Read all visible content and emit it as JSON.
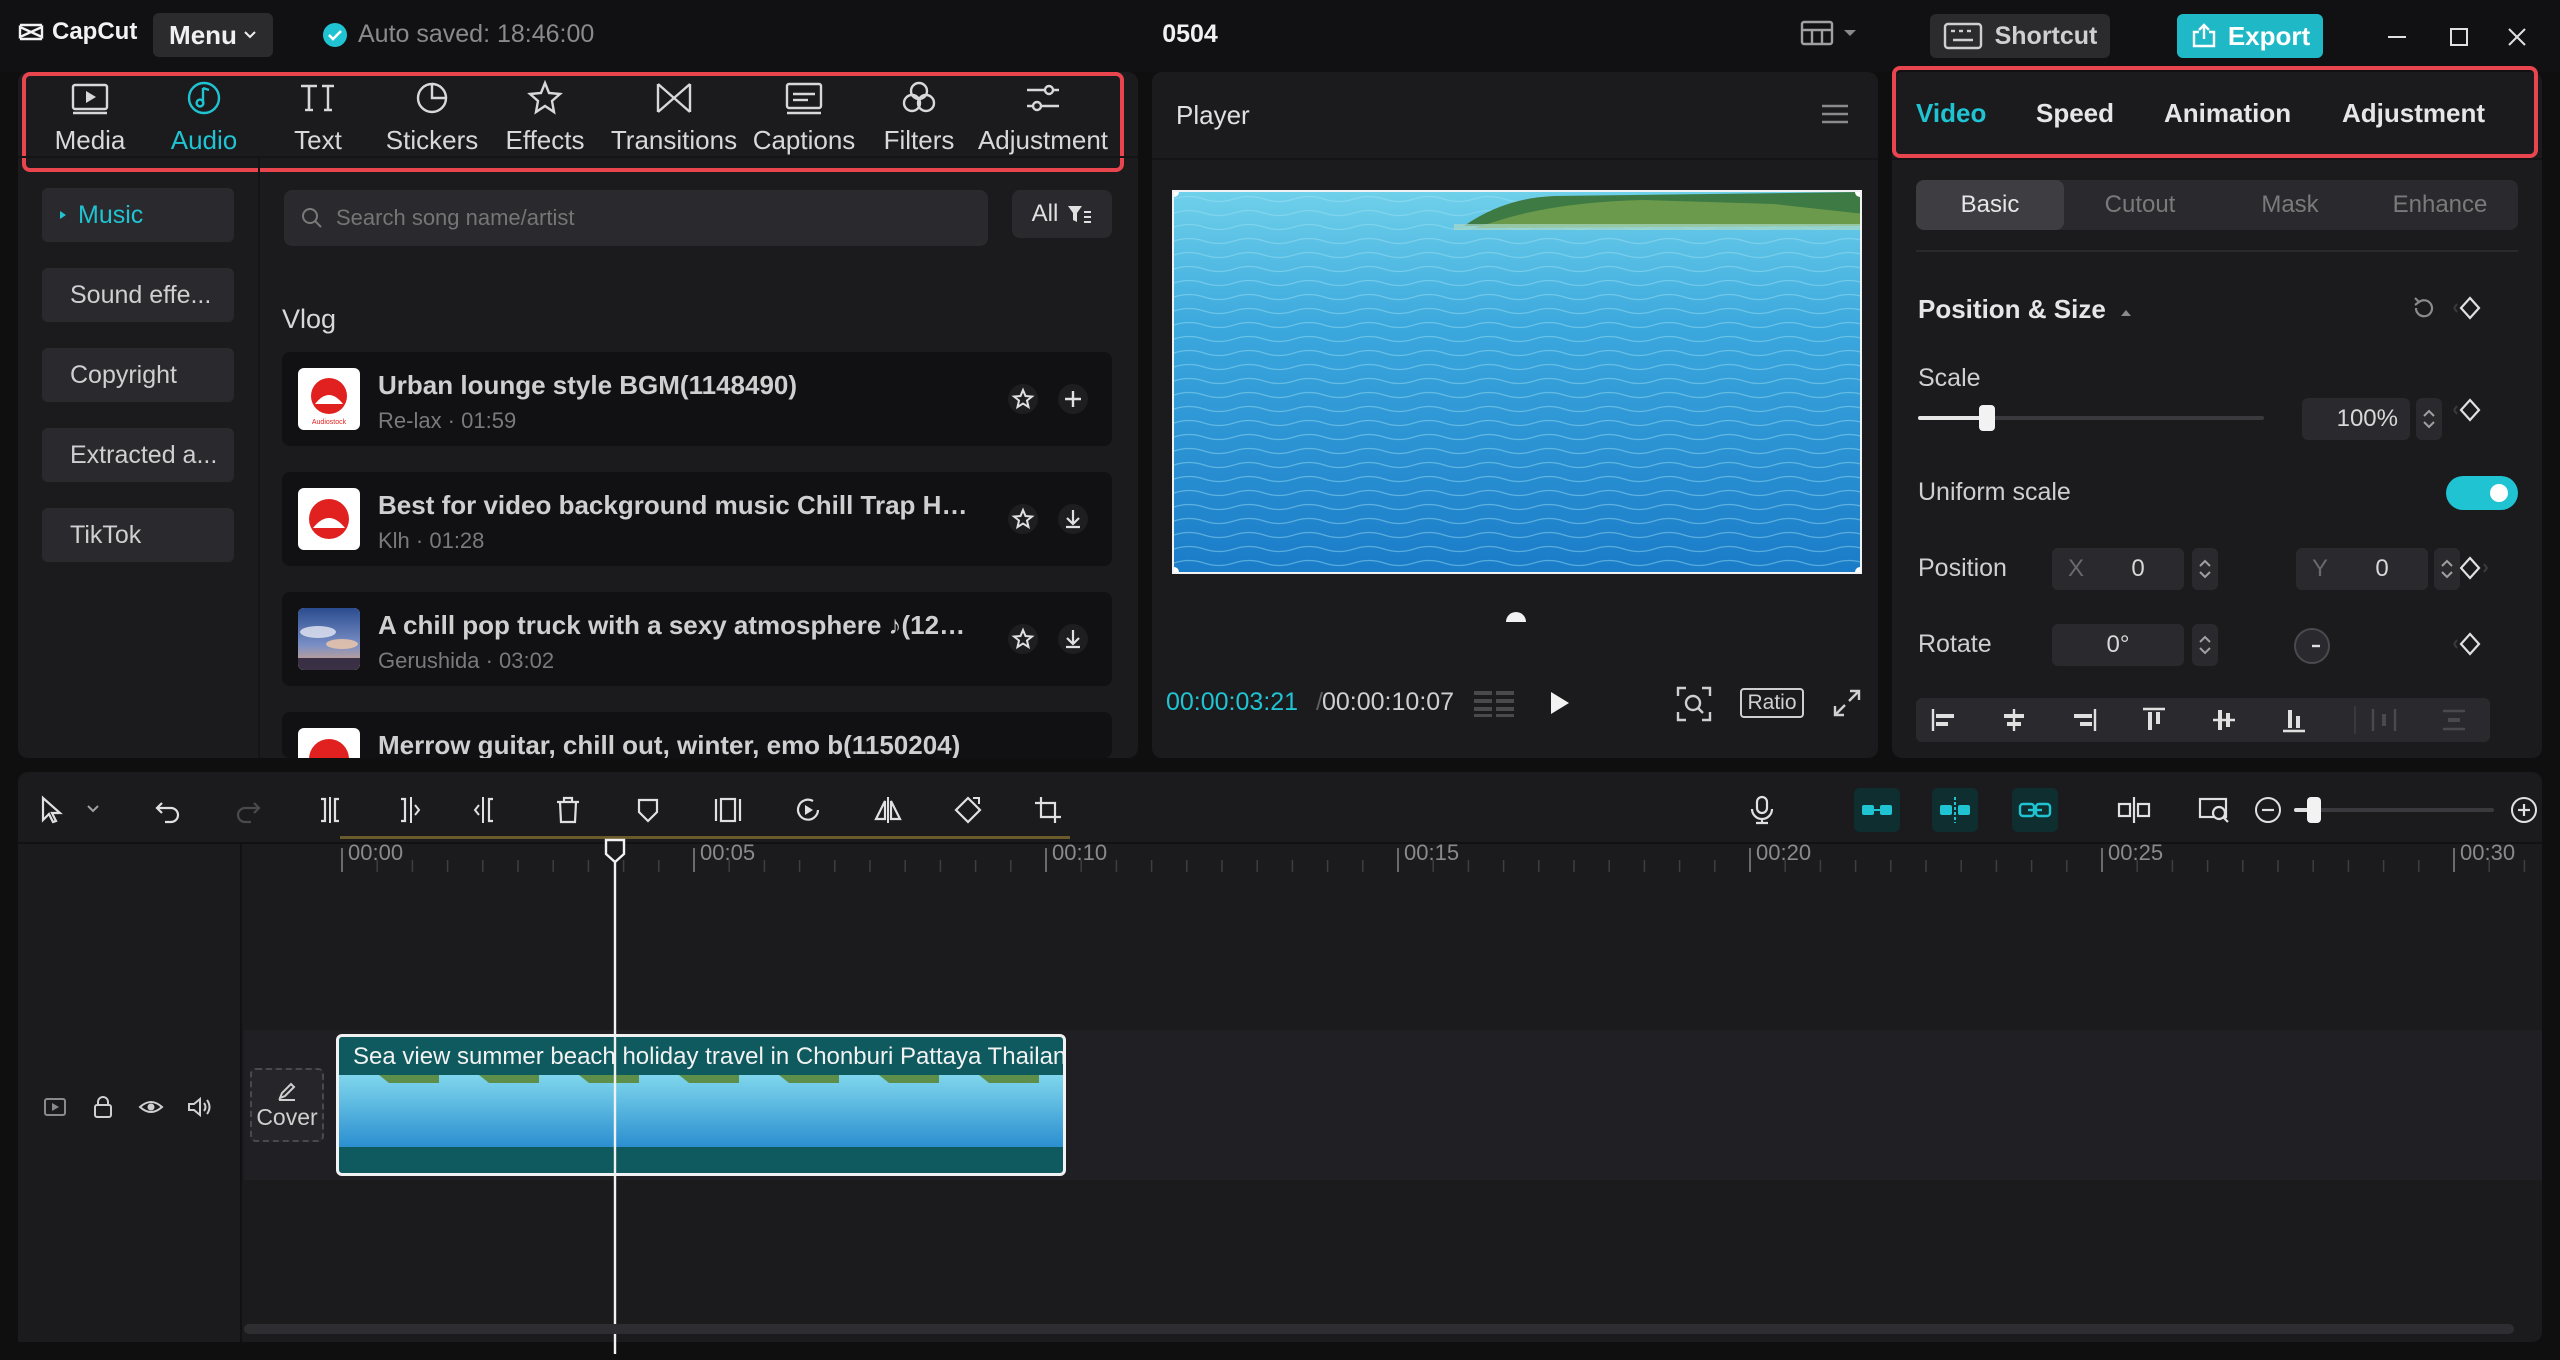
{
  "app": {
    "logo_text": "CapCut",
    "menu_label": "Menu",
    "autosave_text": "Auto saved: 18:46:00",
    "project_title": "0504",
    "shortcut_label": "Shortcut",
    "export_label": "Export"
  },
  "toolbar": {
    "tabs": [
      {
        "label": "Media"
      },
      {
        "label": "Audio"
      },
      {
        "label": "Text"
      },
      {
        "label": "Stickers"
      },
      {
        "label": "Effects"
      },
      {
        "label": "Transitions"
      },
      {
        "label": "Captions"
      },
      {
        "label": "Filters"
      },
      {
        "label": "Adjustment"
      }
    ],
    "active": "Audio"
  },
  "categories": [
    {
      "label": "Music"
    },
    {
      "label": "Sound effe..."
    },
    {
      "label": "Copyright"
    },
    {
      "label": "Extracted a..."
    },
    {
      "label": "TikTok"
    }
  ],
  "search": {
    "placeholder": "Search song name/artist"
  },
  "filter_label": "All",
  "section_title": "Vlog",
  "songs": [
    {
      "title": "Urban lounge style BGM(1148490)",
      "meta": "Re-lax · 01:59",
      "thumb_text": "Audiostock"
    },
    {
      "title": "Best for video background music Chill Trap Hip ...",
      "meta": "Klh · 01:28"
    },
    {
      "title": "A chill pop truck with a sexy atmosphere ♪(1285...",
      "meta": "Gerushida · 03:02"
    },
    {
      "title": "Merrow guitar, chill out, winter, emo b(1150204)",
      "meta": ""
    }
  ],
  "player": {
    "title": "Player",
    "time_current": "00:00:03:21",
    "time_sep": "/",
    "time_total": "00:00:10:07",
    "ratio_label": "Ratio"
  },
  "properties": {
    "tabs": [
      {
        "label": "Video"
      },
      {
        "label": "Speed"
      },
      {
        "label": "Animation"
      },
      {
        "label": "Adjustment"
      }
    ],
    "segments": [
      {
        "label": "Basic"
      },
      {
        "label": "Cutout"
      },
      {
        "label": "Mask"
      },
      {
        "label": "Enhance"
      }
    ],
    "section_title": "Position & Size",
    "scale_label": "Scale",
    "scale_value": "100%",
    "scale_fraction": 0.2,
    "uniform_label": "Uniform scale",
    "uniform_on": true,
    "position_label": "Position",
    "x_label": "X",
    "x_value": "0",
    "y_label": "Y",
    "y_value": "0",
    "rotate_label": "Rotate",
    "rotate_value": "0°"
  },
  "timeline": {
    "ruler": [
      "00:00",
      "00:05",
      "00:10",
      "00:15",
      "00:20",
      "00:25",
      "00:30"
    ],
    "clip_title": "Sea view summer beach holiday travel in Chonburi Pattaya Thailand",
    "cover_label": "Cover",
    "zoom_fraction": 0.1
  },
  "colors": {
    "accent": "#1fc3d2",
    "export_bg": "#1fb8c7",
    "highlight_box": "#e8454f",
    "clip_bg": "#0f5a5f"
  }
}
